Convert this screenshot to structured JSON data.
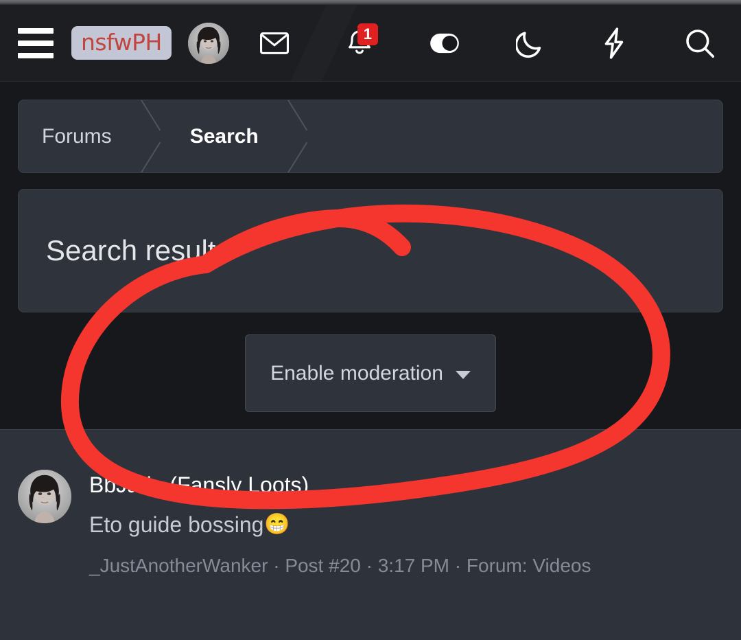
{
  "brand": {
    "logo_text": "nsfwPH",
    "logo_color": "#c0453f",
    "logo_bg": "#c3c6d4"
  },
  "topbar": {
    "menu_label": "Menu",
    "icons": [
      {
        "name": "mail-icon",
        "label": "Inbox"
      },
      {
        "name": "bell-icon",
        "label": "Alerts",
        "badge": "1"
      },
      {
        "name": "contrast-toggle-icon",
        "label": "Contrast"
      },
      {
        "name": "moon-icon",
        "label": "Dark mode"
      },
      {
        "name": "bolt-icon",
        "label": "What's new"
      },
      {
        "name": "search-icon",
        "label": "Search"
      }
    ],
    "badge_color": "#e12121"
  },
  "breadcrumb": {
    "items": [
      {
        "label": "Forums",
        "current": false
      },
      {
        "label": "Search",
        "current": true
      }
    ]
  },
  "main": {
    "page_title": "Search results",
    "moderation_button": "Enable moderation"
  },
  "results": [
    {
      "title": "BbJade (Fansly Loots)",
      "snippet": "Eto guide bossing",
      "snippet_emoji": "😁",
      "author": "_JustAnotherWanker",
      "post_number": "Post #20",
      "time": "3:17 PM",
      "forum": "Forum: Videos",
      "separator": "·"
    }
  ],
  "annotation": {
    "type": "freehand-ellipse",
    "color": "#f4362f",
    "target": "Enable moderation"
  }
}
